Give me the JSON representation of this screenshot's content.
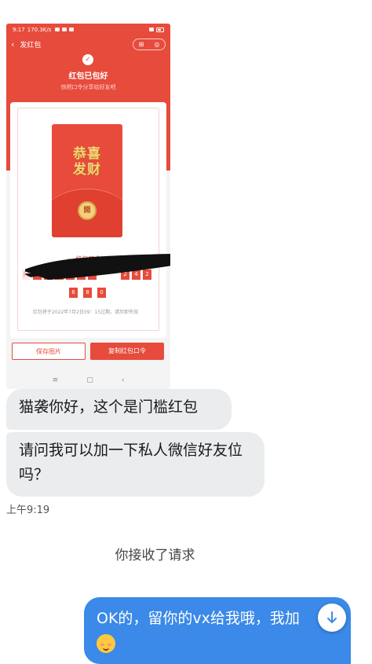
{
  "screenshot": {
    "status": {
      "time": "9:17",
      "speed": "170.3K/s"
    },
    "nav": {
      "back_glyph": "‹",
      "title": "发红包",
      "capsule_left": "⊞",
      "capsule_right": "◎"
    },
    "header": {
      "check_glyph": "✓",
      "title": "红包已包好",
      "subtitle": "快把口令分享给好友吧"
    },
    "envelope": {
      "line1": "恭喜",
      "line2": "发财",
      "seal": "開"
    },
    "code": {
      "label": "— 红包口令 —",
      "row1": [
        "门",
        "",
        "",
        "",
        "",
        "",
        "",
        "2",
        "4",
        "2"
      ],
      "row2": [
        "6",
        "8",
        "0"
      ]
    },
    "expire_text": "红包将于2022年7月2日09：15过期，请尽即失效",
    "buttons": {
      "save": "保存图片",
      "copy": "复制红包口令"
    },
    "sysnav": {
      "menu": "≡",
      "home": "▢",
      "back": "‹"
    },
    "colors": {
      "brand_red": "#e64b3c",
      "gold": "#f7d27a"
    }
  },
  "chat": {
    "messages_in": [
      "猫袭你好，这个是门槛红包",
      "请问我可以加一下私人微信好友位吗？"
    ],
    "time": "上午9:19",
    "system_msg": "你接收了请求",
    "message_out": "OK的，留你的vx给我哦，我加",
    "emoji_icon": "smiling-face-with-hearts-icon",
    "colors": {
      "incoming": "#eaecee",
      "outgoing": "#3b89e8"
    }
  }
}
